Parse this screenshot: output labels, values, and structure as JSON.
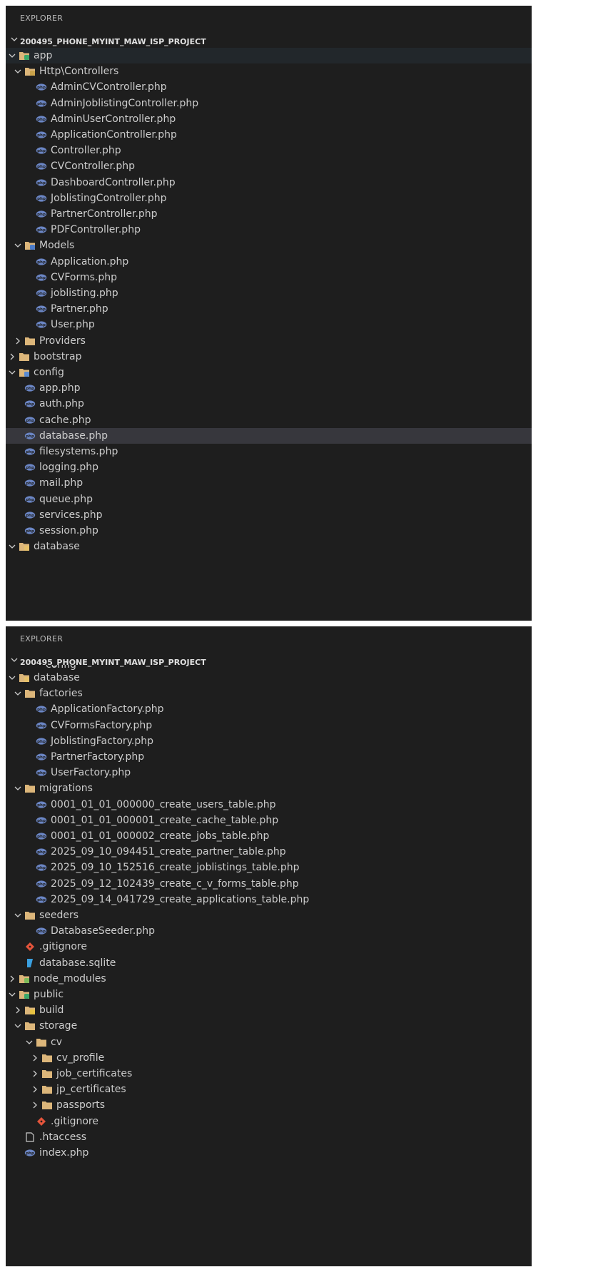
{
  "colors": {
    "background": "#1e1e1e",
    "text": "#cccccc",
    "selected_row": "#37373d",
    "php_icon": "#6b86c5",
    "folder_icon": "#dcb67a",
    "git_icon": "#e4543b",
    "sqlite_icon": "#3aa0e0"
  },
  "panels": [
    {
      "explorer_label": "EXPLORER",
      "project_name": "200495_PHONE_MYINT_MAW_ISP_PROJECT",
      "project_expanded": true,
      "rows": [
        {
          "depth": 1,
          "icon": "folder-app-icon",
          "expanded": true,
          "label": "app",
          "highlight": true
        },
        {
          "depth": 2,
          "icon": "folder-controller-icon",
          "expanded": true,
          "label": "Http\\Controllers"
        },
        {
          "depth": 3,
          "icon": "php-file-icon",
          "label": "AdminCVController.php"
        },
        {
          "depth": 3,
          "icon": "php-file-icon",
          "label": "AdminJoblistingController.php"
        },
        {
          "depth": 3,
          "icon": "php-file-icon",
          "label": "AdminUserController.php"
        },
        {
          "depth": 3,
          "icon": "php-file-icon",
          "label": "ApplicationController.php"
        },
        {
          "depth": 3,
          "icon": "php-file-icon",
          "label": "Controller.php"
        },
        {
          "depth": 3,
          "icon": "php-file-icon",
          "label": "CVController.php"
        },
        {
          "depth": 3,
          "icon": "php-file-icon",
          "label": "DashboardController.php"
        },
        {
          "depth": 3,
          "icon": "php-file-icon",
          "label": "JoblistingController.php"
        },
        {
          "depth": 3,
          "icon": "php-file-icon",
          "label": "PartnerController.php"
        },
        {
          "depth": 3,
          "icon": "php-file-icon",
          "label": "PDFController.php"
        },
        {
          "depth": 2,
          "icon": "folder-models-icon",
          "expanded": true,
          "label": "Models"
        },
        {
          "depth": 3,
          "icon": "php-file-icon",
          "label": "Application.php"
        },
        {
          "depth": 3,
          "icon": "php-file-icon",
          "label": "CVForms.php"
        },
        {
          "depth": 3,
          "icon": "php-file-icon",
          "label": "joblisting.php"
        },
        {
          "depth": 3,
          "icon": "php-file-icon",
          "label": "Partner.php"
        },
        {
          "depth": 3,
          "icon": "php-file-icon",
          "label": "User.php"
        },
        {
          "depth": 2,
          "icon": "folder-icon",
          "expanded": false,
          "label": "Providers"
        },
        {
          "depth": 1,
          "icon": "folder-icon",
          "expanded": false,
          "label": "bootstrap"
        },
        {
          "depth": 1,
          "icon": "folder-config-icon",
          "expanded": true,
          "label": "config"
        },
        {
          "depth": 2,
          "icon": "php-file-icon",
          "label": "app.php"
        },
        {
          "depth": 2,
          "icon": "php-file-icon",
          "label": "auth.php"
        },
        {
          "depth": 2,
          "icon": "php-file-icon",
          "label": "cache.php"
        },
        {
          "depth": 2,
          "icon": "php-file-icon",
          "label": "database.php",
          "selected": true
        },
        {
          "depth": 2,
          "icon": "php-file-icon",
          "label": "filesystems.php"
        },
        {
          "depth": 2,
          "icon": "php-file-icon",
          "label": "logging.php"
        },
        {
          "depth": 2,
          "icon": "php-file-icon",
          "label": "mail.php"
        },
        {
          "depth": 2,
          "icon": "php-file-icon",
          "label": "queue.php"
        },
        {
          "depth": 2,
          "icon": "php-file-icon",
          "label": "services.php"
        },
        {
          "depth": 2,
          "icon": "php-file-icon",
          "label": "session.php"
        },
        {
          "depth": 1,
          "icon": "folder-database-icon",
          "expanded": true,
          "label": "database"
        }
      ]
    },
    {
      "explorer_label": "EXPLORER",
      "project_name": "200495_PHONE_MYINT_MAW_ISP_PROJECT",
      "project_expanded": true,
      "partial_row_label": "config",
      "rows": [
        {
          "depth": 1,
          "icon": "folder-database-icon",
          "expanded": true,
          "label": "database"
        },
        {
          "depth": 2,
          "icon": "folder-icon",
          "expanded": true,
          "label": "factories"
        },
        {
          "depth": 3,
          "icon": "php-file-icon",
          "label": "ApplicationFactory.php"
        },
        {
          "depth": 3,
          "icon": "php-file-icon",
          "label": "CVFormsFactory.php"
        },
        {
          "depth": 3,
          "icon": "php-file-icon",
          "label": "JoblistingFactory.php"
        },
        {
          "depth": 3,
          "icon": "php-file-icon",
          "label": "PartnerFactory.php"
        },
        {
          "depth": 3,
          "icon": "php-file-icon",
          "label": "UserFactory.php"
        },
        {
          "depth": 2,
          "icon": "folder-icon",
          "expanded": true,
          "label": "migrations"
        },
        {
          "depth": 3,
          "icon": "php-file-icon",
          "label": "0001_01_01_000000_create_users_table.php"
        },
        {
          "depth": 3,
          "icon": "php-file-icon",
          "label": "0001_01_01_000001_create_cache_table.php"
        },
        {
          "depth": 3,
          "icon": "php-file-icon",
          "label": "0001_01_01_000002_create_jobs_table.php"
        },
        {
          "depth": 3,
          "icon": "php-file-icon",
          "label": "2025_09_10_094451_create_partner_table.php"
        },
        {
          "depth": 3,
          "icon": "php-file-icon",
          "label": "2025_09_10_152516_create_joblistings_table.php"
        },
        {
          "depth": 3,
          "icon": "php-file-icon",
          "label": "2025_09_12_102439_create_c_v_forms_table.php"
        },
        {
          "depth": 3,
          "icon": "php-file-icon",
          "label": "2025_09_14_041729_create_applications_table.php"
        },
        {
          "depth": 2,
          "icon": "folder-icon",
          "expanded": true,
          "label": "seeders"
        },
        {
          "depth": 3,
          "icon": "php-file-icon",
          "label": "DatabaseSeeder.php"
        },
        {
          "depth": 2,
          "icon": "git-file-icon",
          "label": ".gitignore"
        },
        {
          "depth": 2,
          "icon": "sqlite-file-icon",
          "label": "database.sqlite"
        },
        {
          "depth": 1,
          "icon": "folder-node-icon",
          "expanded": false,
          "label": "node_modules"
        },
        {
          "depth": 1,
          "icon": "folder-public-icon",
          "expanded": true,
          "label": "public"
        },
        {
          "depth": 2,
          "icon": "folder-build-icon",
          "expanded": false,
          "label": "build"
        },
        {
          "depth": 2,
          "icon": "folder-icon",
          "expanded": true,
          "label": "storage"
        },
        {
          "depth": 3,
          "icon": "folder-icon",
          "expanded": true,
          "label": "cv"
        },
        {
          "depth": 4,
          "icon": "folder-icon",
          "expanded": false,
          "label": "cv_profile"
        },
        {
          "depth": 4,
          "icon": "folder-icon",
          "expanded": false,
          "label": "job_certificates"
        },
        {
          "depth": 4,
          "icon": "folder-icon",
          "expanded": false,
          "label": "jp_certificates"
        },
        {
          "depth": 4,
          "icon": "folder-icon",
          "expanded": false,
          "label": "passports"
        },
        {
          "depth": 3,
          "icon": "git-file-icon",
          "label": ".gitignore"
        },
        {
          "depth": 2,
          "icon": "file-icon",
          "label": ".htaccess"
        },
        {
          "depth": 2,
          "icon": "php-file-icon",
          "label": "index.php"
        }
      ]
    }
  ]
}
